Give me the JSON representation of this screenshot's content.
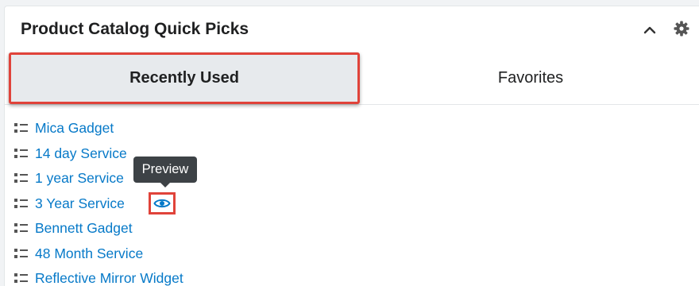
{
  "dashlet": {
    "title": "Product Catalog Quick Picks",
    "header_icons": {
      "collapse": "chevron-up-icon",
      "settings": "gear-icon"
    }
  },
  "tabs": [
    {
      "label": "Recently Used",
      "active": true
    },
    {
      "label": "Favorites",
      "active": false
    }
  ],
  "items": [
    {
      "label": "Mica Gadget"
    },
    {
      "label": "14 day Service"
    },
    {
      "label": "1 year Service"
    },
    {
      "label": "3 Year Service"
    },
    {
      "label": "Bennett Gadget"
    },
    {
      "label": "48 Month Service"
    },
    {
      "label": "Reflective Mirror Widget"
    }
  ],
  "tooltip": {
    "text": "Preview"
  },
  "preview_icon": "eye-icon",
  "list_item_icon": "list-icon",
  "colors": {
    "link": "#0679c8",
    "highlight": "#e0433a",
    "active_tab_bg": "#e7eaed",
    "tooltip_bg": "#3d4246"
  }
}
